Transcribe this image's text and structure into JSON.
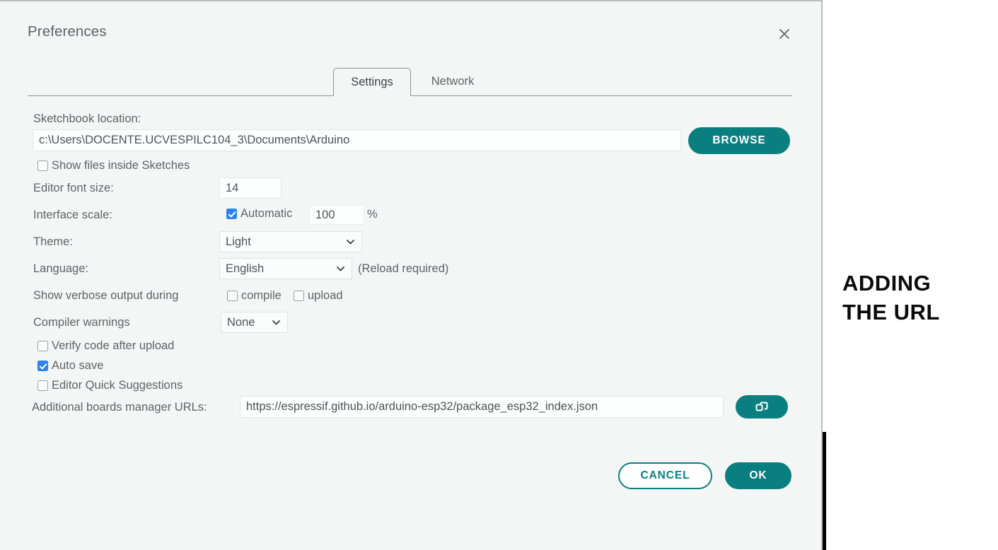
{
  "dialog": {
    "title": "Preferences",
    "close_icon": "close-icon"
  },
  "tabs": [
    {
      "label": "Settings",
      "active": true
    },
    {
      "label": "Network",
      "active": false
    }
  ],
  "settings": {
    "sketchbook": {
      "label": "Sketchbook location:",
      "value": "c:\\Users\\DOCENTE.UCVESPILC104_3\\Documents\\Arduino",
      "browse_label": "BROWSE"
    },
    "show_files_inside_sketches": {
      "label": "Show files inside Sketches",
      "checked": false
    },
    "editor_font_size": {
      "label": "Editor font size:",
      "value": "14"
    },
    "interface_scale": {
      "label": "Interface scale:",
      "automatic_label": "Automatic",
      "automatic_checked": true,
      "value": "100",
      "unit": "%"
    },
    "theme": {
      "label": "Theme:",
      "value": "Light"
    },
    "language": {
      "label": "Language:",
      "value": "English",
      "note": "(Reload required)"
    },
    "verbose_output": {
      "label": "Show verbose output during",
      "compile_label": "compile",
      "compile_checked": false,
      "upload_label": "upload",
      "upload_checked": false
    },
    "compiler_warnings": {
      "label": "Compiler warnings",
      "value": "None"
    },
    "verify_code_after_upload": {
      "label": "Verify code after upload",
      "checked": false
    },
    "auto_save": {
      "label": "Auto save",
      "checked": true
    },
    "editor_quick_suggestions": {
      "label": "Editor Quick Suggestions",
      "checked": false
    },
    "additional_urls": {
      "label": "Additional boards manager URLs:",
      "value": "https://espressif.github.io/arduino-esp32/package_esp32_index.json",
      "expand_icon": "open-windows-icon"
    }
  },
  "footer": {
    "cancel_label": "CANCEL",
    "ok_label": "OK"
  },
  "annotation": {
    "line1": "ADDING",
    "line2": "THE URL"
  },
  "colors": {
    "accent_teal": "#0a7f7f",
    "checkbox_blue": "#2a82f0",
    "dialog_background": "#f4f6f6",
    "text_gray": "#5c6464",
    "annotation_black": "#0a0a0a"
  }
}
